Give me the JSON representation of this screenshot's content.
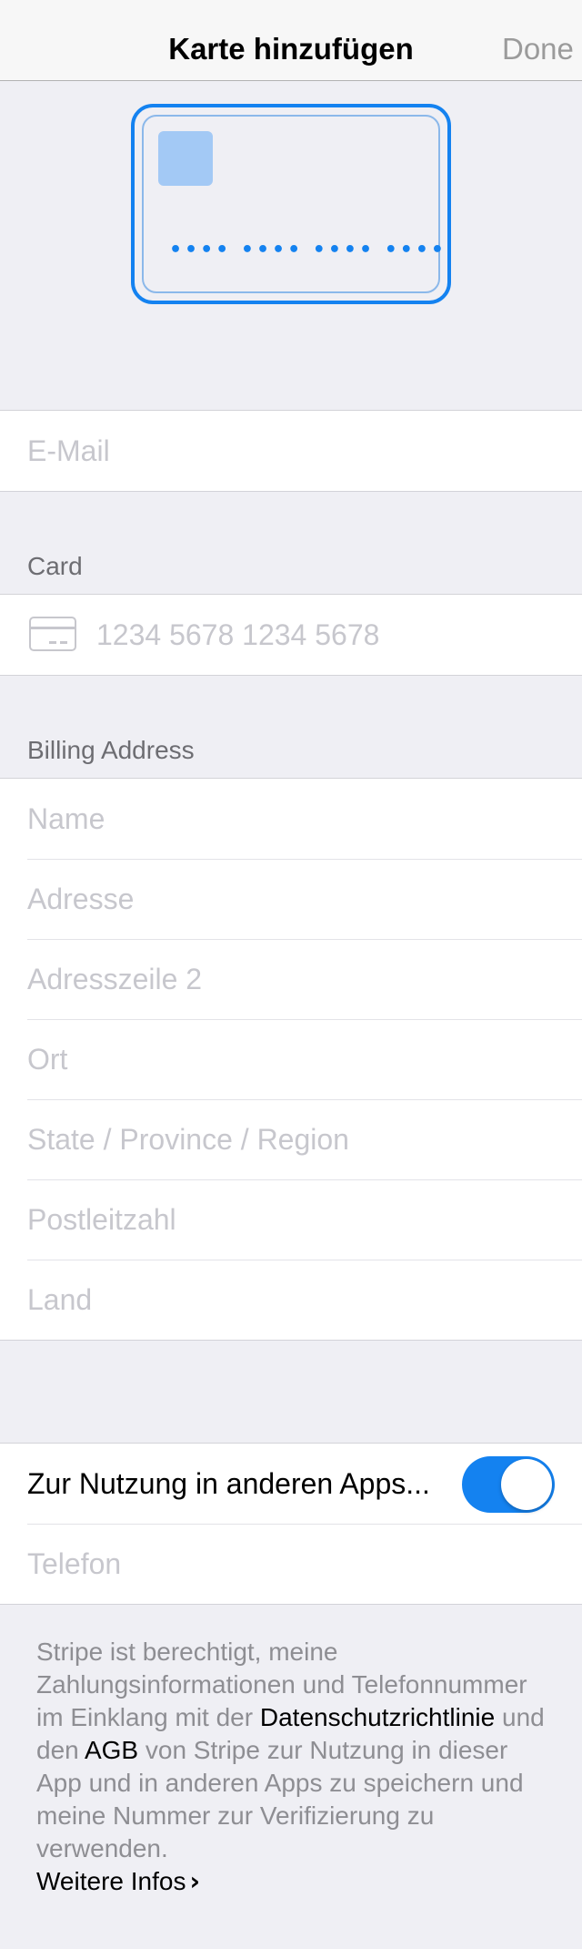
{
  "nav": {
    "title": "Karte hinzufügen",
    "done_label": "Done"
  },
  "card_preview": {
    "number_mask": "•••• •••• •••• ••••",
    "accent_color": "#1482f0"
  },
  "email": {
    "placeholder": "E-Mail"
  },
  "card_section": {
    "header": "Card",
    "number_placeholder": "1234 5678 1234 5678",
    "icon": "credit-card-icon"
  },
  "billing": {
    "header": "Billing Address",
    "fields": [
      {
        "placeholder": "Name"
      },
      {
        "placeholder": "Adresse"
      },
      {
        "placeholder": "Adresszeile 2"
      },
      {
        "placeholder": "Ort"
      },
      {
        "placeholder": "State / Province / Region"
      },
      {
        "placeholder": "Postleitzahl"
      },
      {
        "placeholder": "Land"
      }
    ]
  },
  "remember": {
    "label": "Zur Nutzung in anderen Apps...",
    "toggle_on": true,
    "phone_placeholder": "Telefon"
  },
  "footer": {
    "text_1": "Stripe ist berechtigt, meine Zahlungsinformationen und Telefonnummer im Einklang mit der ",
    "privacy_link": "Datenschutzrichtlinie",
    "text_2": " und den ",
    "terms_link": "AGB",
    "text_3": " von Stripe zur Nutzung in dieser App und in anderen Apps zu speichern und meine Nummer zur Verifizierung zu verwenden.",
    "more_info": "Weitere Infos"
  }
}
